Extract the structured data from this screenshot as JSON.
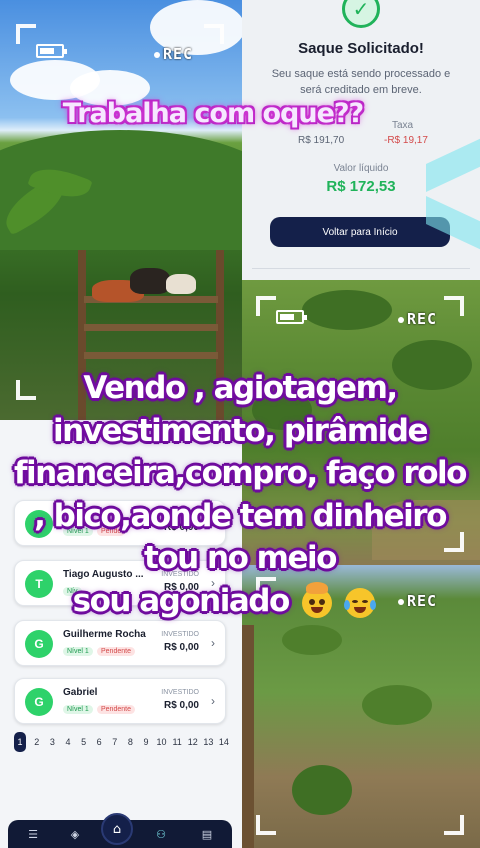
{
  "overlay": {
    "top_caption": "Trabalha com oque??",
    "lines": [
      "Vendo , agiotagem,",
      "investimento, pirâmide",
      "financeira,compro, faço rolo",
      ", bico,aonde tem dinheiro",
      "tou no meio",
      "sou agoniado"
    ],
    "emojis": [
      "exploding-head-emoji",
      "tears-of-joy-emoji"
    ]
  },
  "camera_hud": {
    "rec_label": "REC"
  },
  "withdraw_card": {
    "title": "Saque Solicitado!",
    "subtitle": "Seu saque está sendo processado e será creditado em breve.",
    "gross_value": "R$ 191,70",
    "fee_label": "Taxa",
    "fee_value": "-R$ 19,17",
    "net_label": "Valor líquido",
    "net_value": "R$ 172,53",
    "button_label": "Voltar para Início"
  },
  "investor_list": {
    "rows": [
      {
        "initial": "",
        "name": "",
        "level": "Nível 1",
        "status": "Pende",
        "invested_label": "",
        "amount": "R$ 0,00"
      },
      {
        "initial": "T",
        "name": "Tiago Augusto ...",
        "level": "Nív",
        "status": "",
        "invested_label": "INVESTIDO",
        "amount": "R$ 0,00"
      },
      {
        "initial": "G",
        "name": "Guilherme Rocha",
        "level": "Nível 1",
        "status": "Pendente",
        "invested_label": "INVESTIDO",
        "amount": "R$ 0,00"
      },
      {
        "initial": "G",
        "name": "Gabriel",
        "level": "Nível 1",
        "status": "Pendente",
        "invested_label": "INVESTIDO",
        "amount": "R$ 0,00"
      }
    ],
    "pages": [
      "1",
      "2",
      "3",
      "4",
      "5",
      "6",
      "7",
      "8",
      "9",
      "10",
      "11",
      "12",
      "13",
      "14"
    ],
    "active_page": "1"
  },
  "colors": {
    "accent_green": "#20b35a",
    "navy": "#14204a",
    "caption_stroke": "#6a0a9a",
    "top_caption_stroke": "#b020c0"
  },
  "icons": [
    "check-circle-icon",
    "home-icon",
    "battery-icon",
    "menu-icon",
    "layers-icon",
    "users-icon",
    "document-icon",
    "chevron-right-icon"
  ]
}
